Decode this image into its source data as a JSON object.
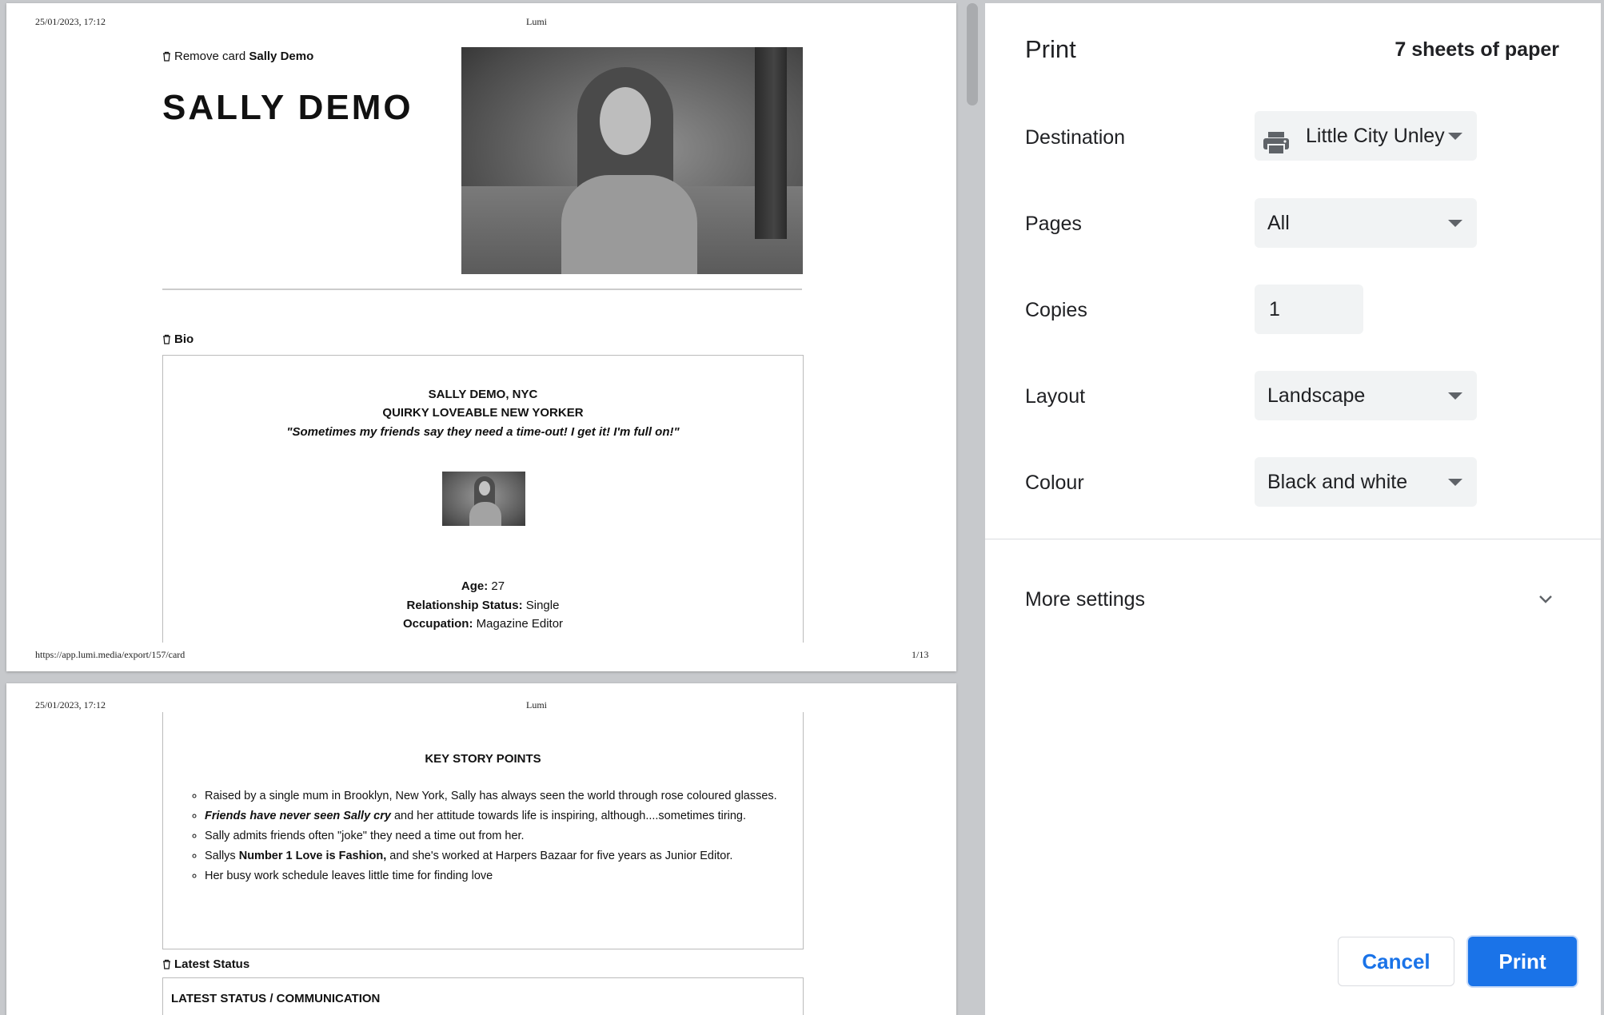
{
  "preview": {
    "page1": {
      "header_left": "25/01/2023, 17:12",
      "header_center": "Lumi",
      "footer_left": "https://app.lumi.media/export/157/card",
      "footer_right": "1/13",
      "remove_card_text": "Remove card",
      "remove_card_name": "Sally Demo",
      "name_title": "SALLY DEMO",
      "bio_label": "Bio",
      "bio_line1": "SALLY DEMO, NYC",
      "bio_line2": "QUIRKY LOVEABLE NEW YORKER",
      "bio_quote": "\"Sometimes my friends say they need a time-out! I get it! I'm full on!\"",
      "age_label": "Age:",
      "age_value": "27",
      "relationship_label": "Relationship Status:",
      "relationship_value": "Single",
      "occupation_label": "Occupation:",
      "occupation_value": "Magazine Editor"
    },
    "page2": {
      "header_left": "25/01/2023, 17:12",
      "header_center": "Lumi",
      "key_story_title": "KEY STORY POINTS",
      "bullets": [
        {
          "plain": "Raised by a single mum in Brooklyn, New York, Sally has always seen the world through rose coloured glasses."
        },
        {
          "bold_italic": "Friends have never seen Sally cry",
          "plain": " and her attitude towards life is inspiring, although....sometimes tiring."
        },
        {
          "plain": "Sally admits friends often \"joke\" they need a time out from her."
        },
        {
          "prefix": "Sallys ",
          "bold": "Number 1 Love is Fashion,",
          "plain": " and she's worked at Harpers Bazaar for five years as Junior Editor."
        },
        {
          "plain": "Her busy work schedule leaves little time for finding love"
        }
      ],
      "latest_status_label": "Latest Status",
      "latest_status_title": "LATEST STATUS / COMMUNICATION"
    }
  },
  "panel": {
    "title": "Print",
    "sheets": "7 sheets of paper",
    "destination_label": "Destination",
    "destination_value": "Little City Unley Printer",
    "pages_label": "Pages",
    "pages_value": "All",
    "copies_label": "Copies",
    "copies_value": "1",
    "layout_label": "Layout",
    "layout_value": "Landscape",
    "colour_label": "Colour",
    "colour_value": "Black and white",
    "more_settings": "More settings",
    "cancel_label": "Cancel",
    "print_label": "Print"
  },
  "colors": {
    "accent": "#1a73e8",
    "select_bg": "#f1f3f4",
    "preview_bg": "#c7c9cc"
  },
  "icons": [
    "trash-icon",
    "printer-icon",
    "dropdown-caret-icon",
    "chevron-down-icon"
  ]
}
